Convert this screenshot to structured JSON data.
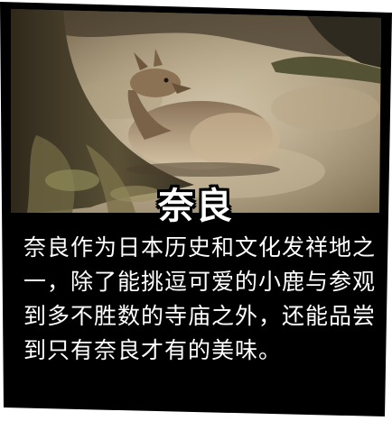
{
  "card": {
    "title": "奈良",
    "description": "奈良作为日本历史和文化发祥地之一，除了能挑逗可爱的小鹿与参观到多不胜数的寺庙之外，还能品尝到只有奈良才有的美味。"
  },
  "colors": {
    "card_background": "#000000",
    "text": "#ffffff",
    "page_background": "#ffffff"
  }
}
